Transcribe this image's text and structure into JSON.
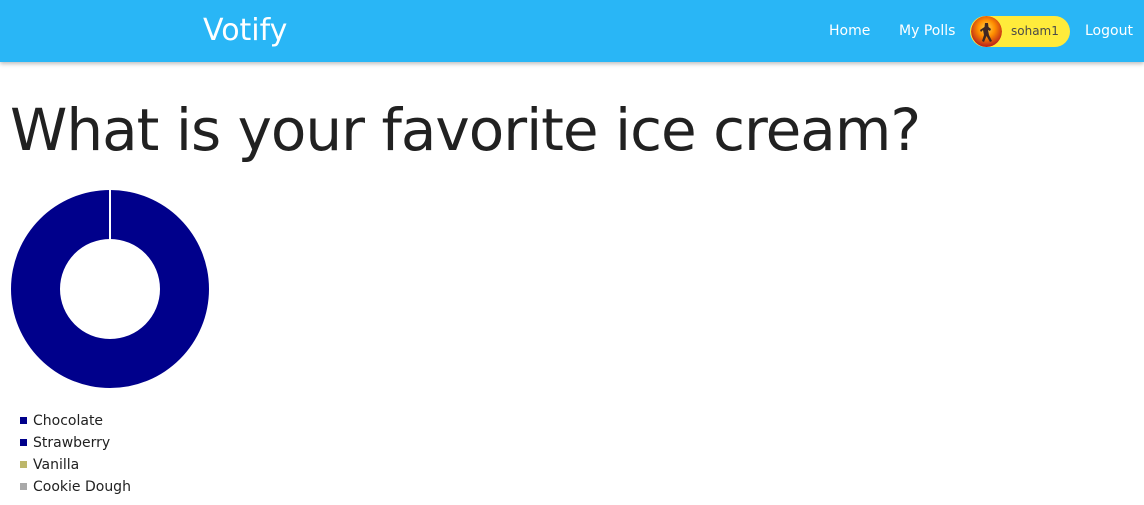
{
  "navbar": {
    "brand": "Votify",
    "links": {
      "home": "Home",
      "my_polls": "My Polls",
      "logout": "Logout"
    },
    "user": {
      "username": "soham1",
      "avatar_icon": "user-avatar"
    },
    "bg_color": "#29b6f6",
    "chip_color": "#ffeb3b"
  },
  "poll": {
    "question": "What is your favorite ice cream?"
  },
  "chart_data": {
    "type": "pie",
    "variant": "doughnut",
    "categories": [
      "Chocolate",
      "Strawberry",
      "Vanilla",
      "Cookie Dough"
    ],
    "values": [
      0,
      1,
      0,
      0
    ],
    "colors": [
      "#00008b",
      "#00008b",
      "#bdb76b",
      "#a9a9a9"
    ],
    "legend_placement": "bottom"
  }
}
